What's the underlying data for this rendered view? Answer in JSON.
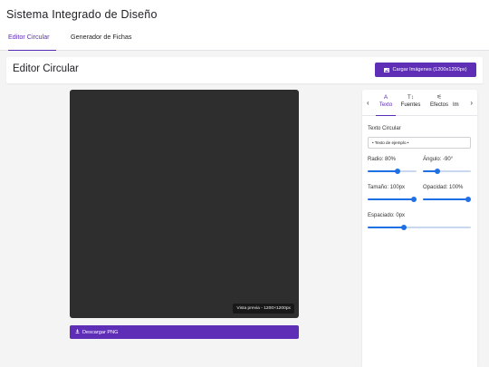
{
  "app": {
    "title": "Sistema Integrado de Diseño"
  },
  "tabs": [
    {
      "label": "Editor Circular",
      "active": true
    },
    {
      "label": "Generador de Fichas",
      "active": false
    }
  ],
  "header": {
    "title": "Editor Circular",
    "upload_label": "Cargar Imágenes (1200x1200px)"
  },
  "canvas": {
    "preview_label": "Vista previa - 1200×1200px",
    "background": "#2e2e2e"
  },
  "download": {
    "label": "Descargar PNG"
  },
  "panel": {
    "tabs": [
      {
        "icon": "A",
        "label": "Texto",
        "active": true
      },
      {
        "icon": "T↕",
        "label": "Fuentes",
        "active": false
      },
      {
        "icon": "⚟",
        "label": "Efectos",
        "active": false
      },
      {
        "icon": "",
        "label": "Im",
        "active": false
      }
    ],
    "text_label": "Texto Circular",
    "text_value": "• Texto de ejemplo •",
    "sliders": {
      "radio": {
        "label": "Radio: 80%",
        "fraction": 0.62
      },
      "angulo": {
        "label": "Ángulo: -90°",
        "fraction": 0.3
      },
      "tamano": {
        "label": "Tamaño: 100px",
        "fraction": 0.95
      },
      "opacidad": {
        "label": "Opacidad: 100%",
        "fraction": 1.0
      },
      "espaciado": {
        "label": "Espaciado: 0px",
        "fraction": 0.35
      }
    }
  },
  "colors": {
    "accent": "#5e2eb6",
    "slider": "#1f6fe5"
  }
}
